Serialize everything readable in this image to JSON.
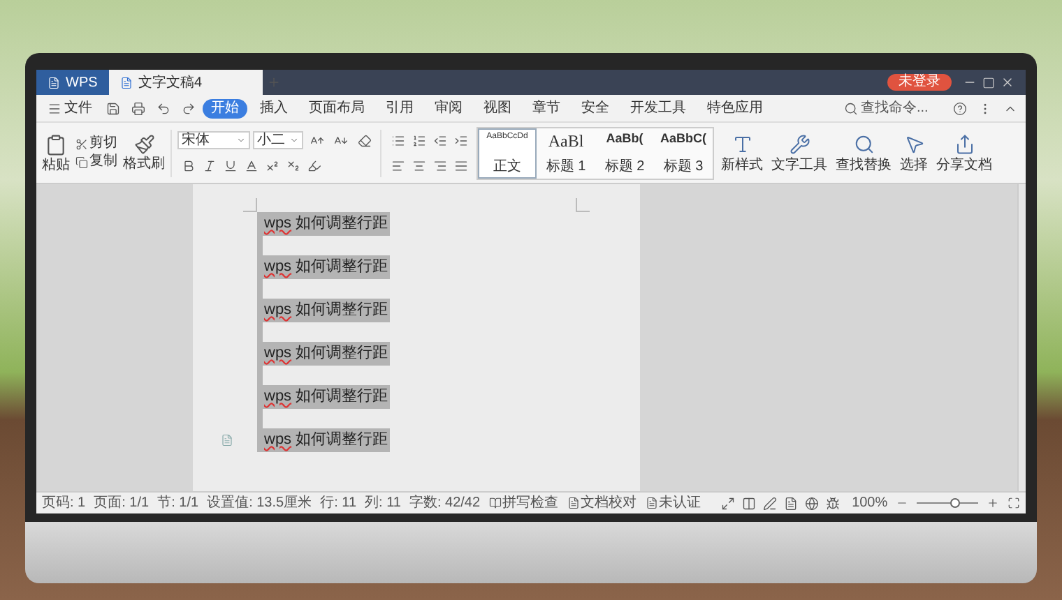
{
  "title_bar": {
    "tabs": [
      {
        "label": "WPS",
        "selected": false
      },
      {
        "label": "文字文稿4",
        "selected": true
      }
    ],
    "login_button": "未登录"
  },
  "menu_bar": {
    "file_menu": "文件",
    "tabs": [
      {
        "label": "开始",
        "selected": true
      },
      {
        "label": "插入",
        "selected": false
      },
      {
        "label": "页面布局",
        "selected": false
      },
      {
        "label": "引用",
        "selected": false
      },
      {
        "label": "审阅",
        "selected": false
      },
      {
        "label": "视图",
        "selected": false
      },
      {
        "label": "章节",
        "selected": false
      },
      {
        "label": "安全",
        "selected": false
      },
      {
        "label": "开发工具",
        "selected": false
      },
      {
        "label": "特色应用",
        "selected": false
      }
    ],
    "search": {
      "placeholder": "查找命令..."
    }
  },
  "ribbon": {
    "paste": "粘贴",
    "cut": "剪切",
    "copy": "复制",
    "format_painter": "格式刷",
    "font_name": "宋体",
    "font_size": "小二",
    "styles": [
      {
        "preview": "AaBbCcDd",
        "label": "正文",
        "selected": true
      },
      {
        "preview": "AaBl",
        "label": "标题 1",
        "selected": false
      },
      {
        "preview": "AaBb(",
        "label": "标题 2",
        "selected": false
      },
      {
        "preview": "AaBbC(",
        "label": "标题 3",
        "selected": false
      }
    ],
    "tools": [
      "新样式",
      "文字工具",
      "查找替换",
      "选择",
      "分享文档"
    ]
  },
  "document": {
    "lines": [
      {
        "misspelled": "wps",
        "text": "如何调整行距"
      },
      {
        "misspelled": "wps",
        "text": "如何调整行距"
      },
      {
        "misspelled": "wps",
        "text": "如何调整行距"
      },
      {
        "misspelled": "wps",
        "text": "如何调整行距"
      },
      {
        "misspelled": "wps",
        "text": "如何调整行距"
      },
      {
        "misspelled": "wps",
        "text": "如何调整行距"
      }
    ]
  },
  "status_bar": {
    "items": [
      "页码: 1",
      "页面: 1/1",
      "节: 1/1",
      "设置值: 13.5厘米",
      "行: 11",
      "列: 11",
      "字数: 42/42"
    ],
    "spell_check": "拼写检查",
    "proofread": "文档校对",
    "certification": "未认证",
    "zoom": "100%",
    "zoom_slider": {
      "level": 0.62
    }
  }
}
